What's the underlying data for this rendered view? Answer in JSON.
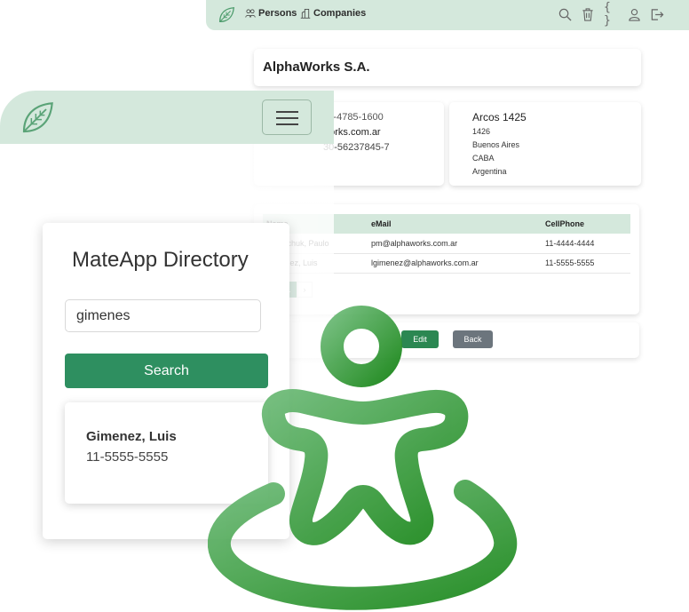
{
  "desktop": {
    "nav": {
      "persons_label": "Persons",
      "companies_label": "Companies",
      "json_icon_label": "{ }"
    },
    "company": {
      "name": "AlphaWorks S.A.",
      "phone": "11-4785-1600",
      "website": "www.alphaworks.com.ar",
      "tax_id": "30-56237845-7",
      "address": {
        "street": "Arcos 1425",
        "zip": "1426",
        "city": "Buenos Aires",
        "state": "CABA",
        "country": "Argentina"
      }
    },
    "persons_table": {
      "headers": [
        "Name",
        "eMail",
        "CellPhone"
      ],
      "rows": [
        [
          "Mielnichuk, Paulo",
          "pm@alphaworks.com.ar",
          "11-4444-4444"
        ],
        [
          "Gimenez, Luis",
          "lgimenez@alphaworks.com.ar",
          "11-5555-5555"
        ]
      ],
      "pager": [
        "‹",
        "1",
        "›"
      ]
    },
    "actions": {
      "edit_label": "Edit",
      "back_label": "Back"
    }
  },
  "mobile": {
    "directory": {
      "title": "MateApp Directory",
      "search_value": "gimenes",
      "search_button": "Search",
      "result": {
        "name": "Gimenez, Luis",
        "phone": "11-5555-5555"
      }
    }
  },
  "colors": {
    "brand_green": "#2e8f60",
    "nav_mint": "#d4e8dc",
    "button_gray": "#6c757d"
  },
  "icons": [
    "leaf-logo-icon",
    "persons-icon",
    "companies-icon",
    "search-icon",
    "trash-icon",
    "json-icon",
    "user-icon",
    "logout-icon",
    "hamburger-menu-icon",
    "mateapp-figure-logo-icon"
  ]
}
